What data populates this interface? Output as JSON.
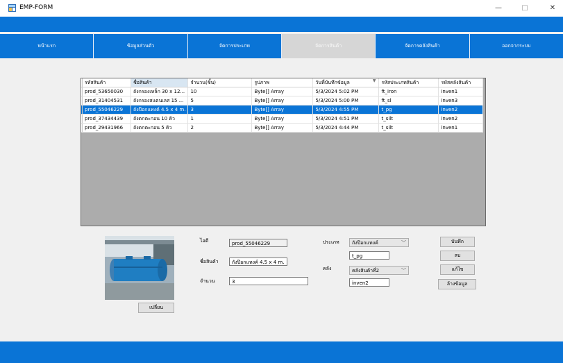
{
  "window": {
    "title": "EMP-FORM",
    "minimize": "—",
    "maximize": "□",
    "close": "✕"
  },
  "menu": [
    "หน้าแรก",
    "ข้อมูลส่วนตัว",
    "จัดการประเภท",
    "จัดการสินค้า",
    "จัดการคลังสินค้า",
    "ออกจากระบบ"
  ],
  "grid": {
    "columns": [
      "รหัสสินค้า",
      "ชื่อสินค้า",
      "จำนวน(ชิ้น)",
      "รูปภาพ",
      "วันที่บันทึกข้อมูล",
      "รหัสประเภทสินค้า",
      "รหัสคลังสินค้า"
    ],
    "sort_indicator": "▼",
    "rows": [
      [
        "prod_53650030",
        "ถังกรองเหล็ก 30 x 12...",
        "10",
        "Byte[] Array",
        "5/3/2024 5:02 PM",
        "ft_iron",
        "inven1"
      ],
      [
        "prod_31404531",
        "ถังกรองสแตนเลส 15 ...",
        "5",
        "Byte[] Array",
        "5/3/2024 5:00 PM",
        "ft_sl",
        "inven3"
      ],
      [
        "prod_55046229",
        "ถังป๊อกแทงค์ 4.5 x 4 m.",
        "3",
        "Byte[] Array",
        "5/3/2024 4:55 PM",
        "t_pg",
        "inven2"
      ],
      [
        "prod_37434439",
        "ถังตกตะกอน 10 คิว",
        "1",
        "Byte[] Array",
        "5/3/2024 4:51 PM",
        "t_silt",
        "inven2"
      ],
      [
        "prod_29431966",
        "ถังตกตะกอน 5 คิว",
        "2",
        "Byte[] Array",
        "5/3/2024 4:44 PM",
        "t_silt",
        "inven1"
      ]
    ],
    "selected_row": 2
  },
  "form": {
    "id_label": "ไอดี",
    "id_value": "prod_55046229",
    "name_label": "ชื่อสินค้า",
    "name_value": "ถังป๊อกแทงค์ 4.5 x 4 m.",
    "qty_label": "จำนวน",
    "qty_value": "3",
    "type_label": "ประเภท",
    "type_select": "ถังป๊อกแทงค์",
    "type_code": "t_pg",
    "inven_label": "คลัง",
    "inven_select": "คลังสินค้าที่2",
    "inven_code": "inven2",
    "change_button": "เปลี่ยน"
  },
  "actions": {
    "save": "บันทึก",
    "delete": "ลบ",
    "edit": "แก้ไข",
    "clear": "ล้างข้อมูล"
  },
  "colors": {
    "accent": "#0a74d6",
    "selected_row": "#0a74d6"
  }
}
